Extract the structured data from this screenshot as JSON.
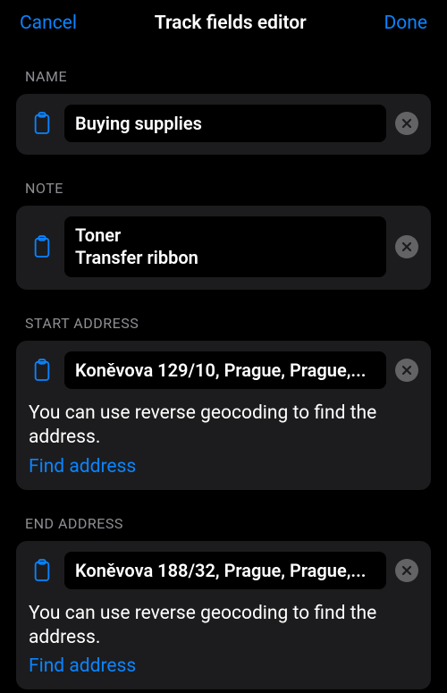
{
  "header": {
    "cancel": "Cancel",
    "title": "Track fields editor",
    "done": "Done"
  },
  "sections": {
    "name": {
      "label": "NAME",
      "value": "Buying supplies"
    },
    "note": {
      "label": "NOTE",
      "value": "Toner\nTransfer ribbon"
    },
    "startAddress": {
      "label": "START ADDRESS",
      "value": "Koněvova 129/10, Prague, Prague,...",
      "helper": "You can use reverse geocoding to find the address.",
      "findLink": "Find address"
    },
    "endAddress": {
      "label": "END ADDRESS",
      "value": "Koněvova 188/32, Prague, Prague,...",
      "helper": "You can use reverse geocoding to find the address.",
      "findLink": "Find address"
    }
  }
}
